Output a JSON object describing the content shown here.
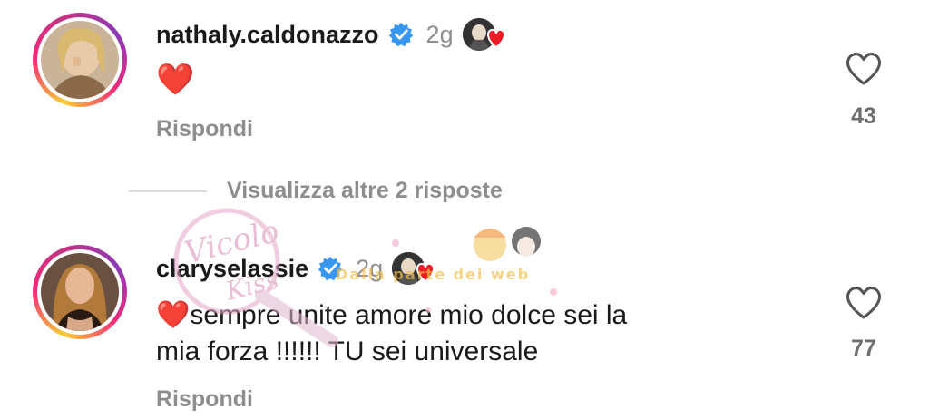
{
  "comments": [
    {
      "username": "nathaly.caldonazzo",
      "time": "2g",
      "text": "❤️",
      "reply_label": "Rispondi",
      "likes": "43",
      "avatar_icon": "user-avatar-blonde-woman",
      "verified": true,
      "liked_by_creator": true
    },
    {
      "username": "claryselassie",
      "time": "2g",
      "text_line1": "❤️sempre unite amore mio dolce sei la",
      "text_line2": "mia forza !!!!!! TU sei universale",
      "reply_label": "Rispondi",
      "likes": "77",
      "avatar_icon": "user-avatar-brunette-woman",
      "verified": true,
      "liked_by_creator": true
    }
  ],
  "view_more_replies": "Visualizza altre 2 risposte",
  "watermark": {
    "script_text": "Vicolo Kiss",
    "banner_text": "Dalla parte dei web"
  },
  "colors": {
    "verified_blue": "#3797f0",
    "heart_red": "#ed1c24",
    "muted_text": "#8e8e8e"
  }
}
